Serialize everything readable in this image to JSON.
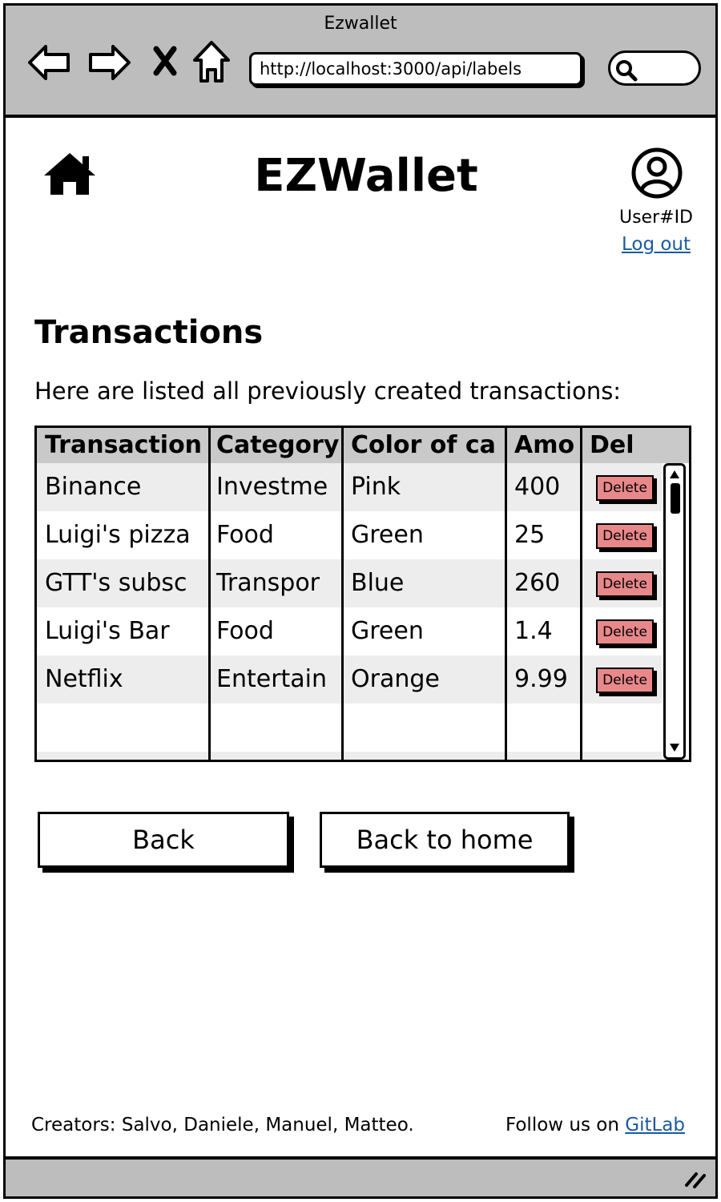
{
  "browser": {
    "window_title": "Ezwallet",
    "url": "http://localhost:3000/api/labels",
    "search_placeholder": ""
  },
  "header": {
    "app_title": "EZWallet",
    "user_id": "User#ID",
    "logout_label": "Log out"
  },
  "main": {
    "title": "Transactions",
    "description": "Here are listed all previously created transactions:",
    "table": {
      "columns": [
        "Transaction",
        "Category",
        "Color of ca",
        "Amo",
        "Del"
      ],
      "rows": [
        {
          "name": "Binance",
          "category": "Investme",
          "color": "Pink",
          "amount": "400",
          "action": "Delete"
        },
        {
          "name": "Luigi's pizza",
          "category": "Food",
          "color": "Green",
          "amount": "25",
          "action": "Delete"
        },
        {
          "name": "GTT's subsc",
          "category": "Transpor",
          "color": "Blue",
          "amount": "260",
          "action": "Delete"
        },
        {
          "name": "Luigi's Bar",
          "category": "Food",
          "color": "Green",
          "amount": "1.4",
          "action": "Delete"
        },
        {
          "name": "Netflix",
          "category": "Entertain",
          "color": "Orange",
          "amount": "9.99",
          "action": "Delete"
        }
      ]
    },
    "buttons": {
      "back": "Back",
      "back_home": "Back to home"
    }
  },
  "footer": {
    "creators": "Creators: Salvo, Daniele, Manuel, Matteo.",
    "follow_prefix": "Follow us on ",
    "gitlab_label": "GitLab"
  },
  "colors": {
    "chrome": "#bdbdbd",
    "delete_button": "#e8888a",
    "link": "#1a5aa0"
  }
}
